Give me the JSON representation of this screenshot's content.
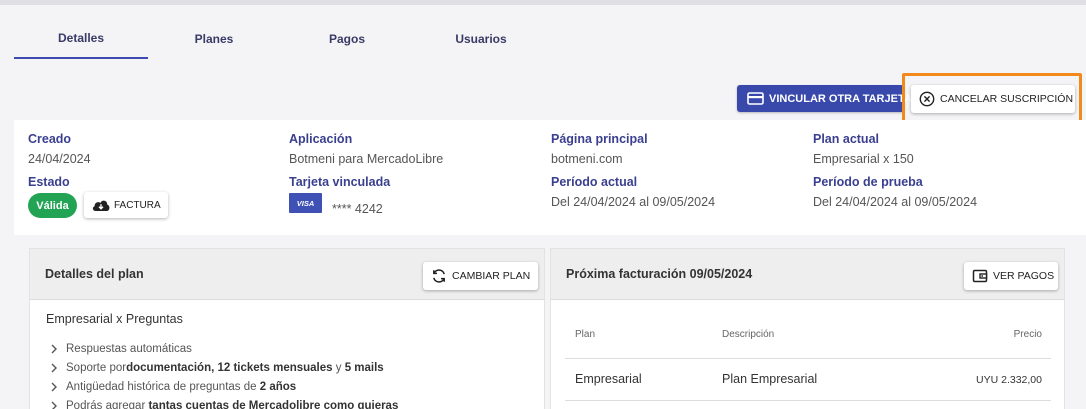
{
  "tabs": [
    {
      "label": "Detalles",
      "active": true
    },
    {
      "label": "Planes",
      "active": false
    },
    {
      "label": "Pagos",
      "active": false
    },
    {
      "label": "Usuarios",
      "active": false
    }
  ],
  "actions": {
    "vincular_label": "VINCULAR OTRA TARJETA",
    "cancelar_label": "CANCELAR SUSCRIPCIÓN"
  },
  "info": {
    "creado": {
      "label": "Creado",
      "value": "24/04/2024"
    },
    "estado": {
      "label": "Estado",
      "badge": "Válida",
      "factura_label": "FACTURA"
    },
    "aplicacion": {
      "label": "Aplicación",
      "value": "Botmeni para MercadoLibre"
    },
    "tarjeta": {
      "label": "Tarjeta vinculada",
      "brand": "VISA",
      "number": "**** 4242"
    },
    "pagina": {
      "label": "Página principal",
      "value": "botmeni.com"
    },
    "periodo_actual": {
      "label": "Período actual",
      "value": "Del 24/04/2024 al 09/05/2024"
    },
    "plan_actual": {
      "label": "Plan actual",
      "value": "Empresarial x 150"
    },
    "periodo_prueba": {
      "label": "Período de prueba",
      "value": "Del 24/04/2024 al 09/05/2024"
    }
  },
  "plan_card": {
    "title": "Detalles del plan",
    "button_label": "CAMBIAR PLAN",
    "plan_name": "Empresarial x Preguntas",
    "features": [
      {
        "pre": "Respuestas automáticas",
        "bold": "",
        "mid": "",
        "bold2": "",
        "post": ""
      },
      {
        "pre": "Soporte por ",
        "bold": "documentación, 12 tickets mensuales",
        "mid": " y ",
        "bold2": "5 mails",
        "post": ""
      },
      {
        "pre": "Antigüedad histórica de preguntas de ",
        "bold": "2 años",
        "mid": "",
        "bold2": "",
        "post": ""
      },
      {
        "pre": "Podrás agregar ",
        "bold": "tantas cuentas de Mercadolibre como quieras",
        "mid": "",
        "bold2": "",
        "post": ""
      }
    ]
  },
  "billing_card": {
    "title": "Próxima facturación 09/05/2024",
    "button_label": "VER PAGOS",
    "columns": [
      "Plan",
      "Descripción",
      "Precio"
    ],
    "rows": [
      {
        "plan": "Empresarial",
        "descripcion": "Plan Empresarial",
        "precio": "UYU 2.332,00"
      }
    ]
  },
  "colors": {
    "accent": "#3949ab",
    "label": "#3a3f8f",
    "success": "#23a455",
    "highlight": "#f28a1b"
  }
}
